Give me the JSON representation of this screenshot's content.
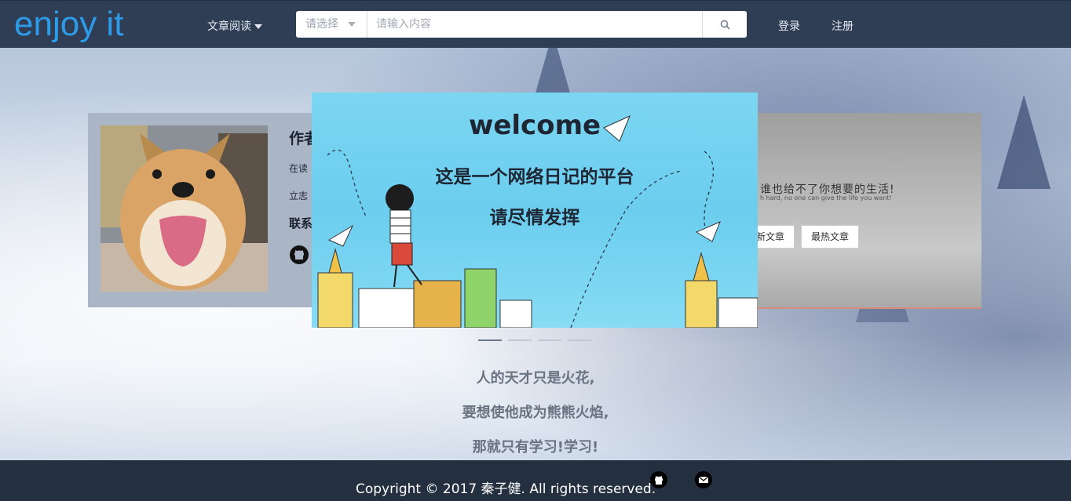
{
  "header": {
    "logo": "enjoy it",
    "nav_dropdown": "文章阅读",
    "search": {
      "select_label": "请选择",
      "placeholder": "请输入内容"
    },
    "login": "登录",
    "register": "注册"
  },
  "left_card": {
    "title": "作者",
    "line1": "在读",
    "line2": "立志",
    "contact": "联系"
  },
  "center_card": {
    "title": "welcome",
    "line1": "这是一个网络日记的平台",
    "line2": "请尽情发挥"
  },
  "right_card": {
    "slogan": "谁也给不了你想要的生活!",
    "sub": "h hard, no one can give the life you want!",
    "btn_new": "新文章",
    "btn_hot": "最热文章"
  },
  "carousel": {
    "count": 4,
    "active": 0
  },
  "quote": {
    "line1": "人的天才只是火花,",
    "line2": "要想使他成为熊熊火焰,",
    "line3": "那就只有学习!学习!"
  },
  "footer": {
    "copyright": "Copyright © 2017 秦子健. All rights reserved."
  },
  "icons": [
    "search-icon",
    "caret-down-icon",
    "github-icon",
    "email-icon"
  ],
  "colors": {
    "header_bg": "#2f3d55",
    "logo": "#2e9be8",
    "footer_bg": "#242f40"
  }
}
